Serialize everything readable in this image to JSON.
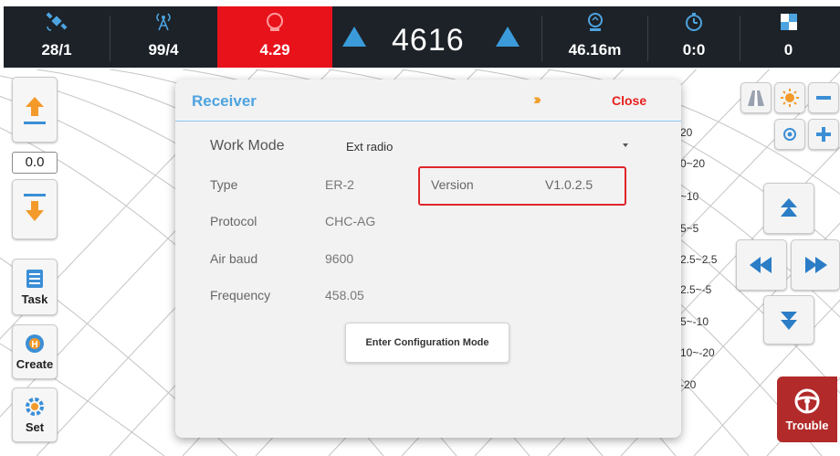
{
  "status_bar": {
    "satellites": "28/1",
    "signal": "99/4",
    "alert_value": "4.29",
    "speed": "4616",
    "distance": "46.16m",
    "time": "0:0",
    "count": "0"
  },
  "map": {
    "legend": [
      "20",
      "0~20",
      "~10",
      "5~5",
      "2.5~2.5",
      "2.5~-5",
      "5~-10",
      "10~-20",
      "-20"
    ]
  },
  "left_toolbar": {
    "offset_value": "0.0",
    "task_label": "Task",
    "create_label": "Create",
    "set_label": "Set"
  },
  "right_controls": {
    "trouble_label": "Trouble"
  },
  "dialog": {
    "title": "Receiver",
    "more_glyph": "›››",
    "close_label": "Close",
    "work_mode_label": "Work Mode",
    "work_mode_value": "Ext radio",
    "type_label": "Type",
    "type_value": "ER-2",
    "version_label": "Version",
    "version_value": "V1.0.2.5",
    "protocol_label": "Protocol",
    "protocol_value": "CHC-AG",
    "air_baud_label": "Air baud",
    "air_baud_value": "9600",
    "frequency_label": "Frequency",
    "frequency_value": "458.05",
    "config_button_label": "Enter Configuration Mode"
  },
  "colors": {
    "accent_blue": "#4da3e0",
    "alert_red": "#e8121b",
    "close_red": "#e8201e",
    "orange": "#f0a030",
    "topbar_bg": "#1c2228"
  }
}
